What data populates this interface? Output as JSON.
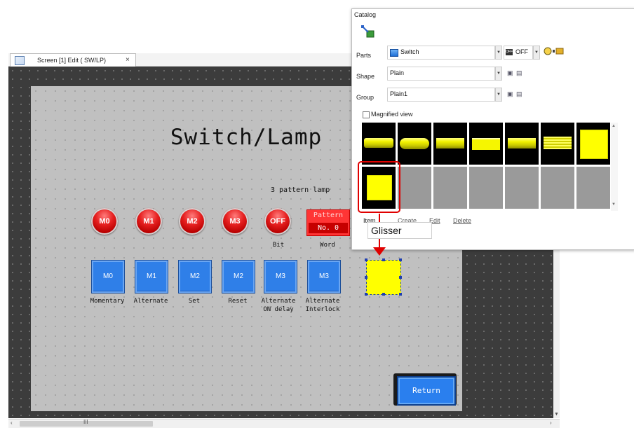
{
  "editor": {
    "tab_title": "Screen [1] Edit (       SW/LP)",
    "tab_close": "×"
  },
  "screen": {
    "title": "Switch/Lamp",
    "pattern_lamp_label": "3 pattern lamp",
    "lamps": [
      "M0",
      "M1",
      "M2",
      "M3",
      "OFF"
    ],
    "pattern_display": {
      "line1": "Pattern",
      "line2": "No. 0"
    },
    "lamp_sublabels": {
      "bit": "Bit",
      "word": "Word"
    },
    "switches": [
      {
        "label": "M0",
        "caption": "Momentary"
      },
      {
        "label": "M1",
        "caption": "Alternate"
      },
      {
        "label": "M2",
        "caption": "Set"
      },
      {
        "label": "M2",
        "caption": "Reset"
      },
      {
        "label": "M3",
        "caption": "Alternate ON delay"
      },
      {
        "label": "M3",
        "caption": "Alternate Interlock"
      }
    ],
    "return_label": "Return"
  },
  "catalog": {
    "title": "Catalog",
    "parts_label": "Parts",
    "parts_value": "Switch",
    "off_label": "OFF",
    "shape_label": "Shape",
    "shape_value": "Plain",
    "group_label": "Group",
    "group_value": "Plain1",
    "magnified_view": "Magnified view",
    "magnified_checked": false,
    "item_label": "Item",
    "create_label": "Create",
    "edit_label": "Edit",
    "delete_label": "Delete"
  },
  "annotation": {
    "callout_text": "Glisser",
    "color": "#e00000"
  },
  "colors": {
    "lamp_red": "#e62020",
    "switch_blue": "#2f7fe8",
    "part_yellow": "#ffff00",
    "canvas_grey": "#c0c0c0"
  }
}
